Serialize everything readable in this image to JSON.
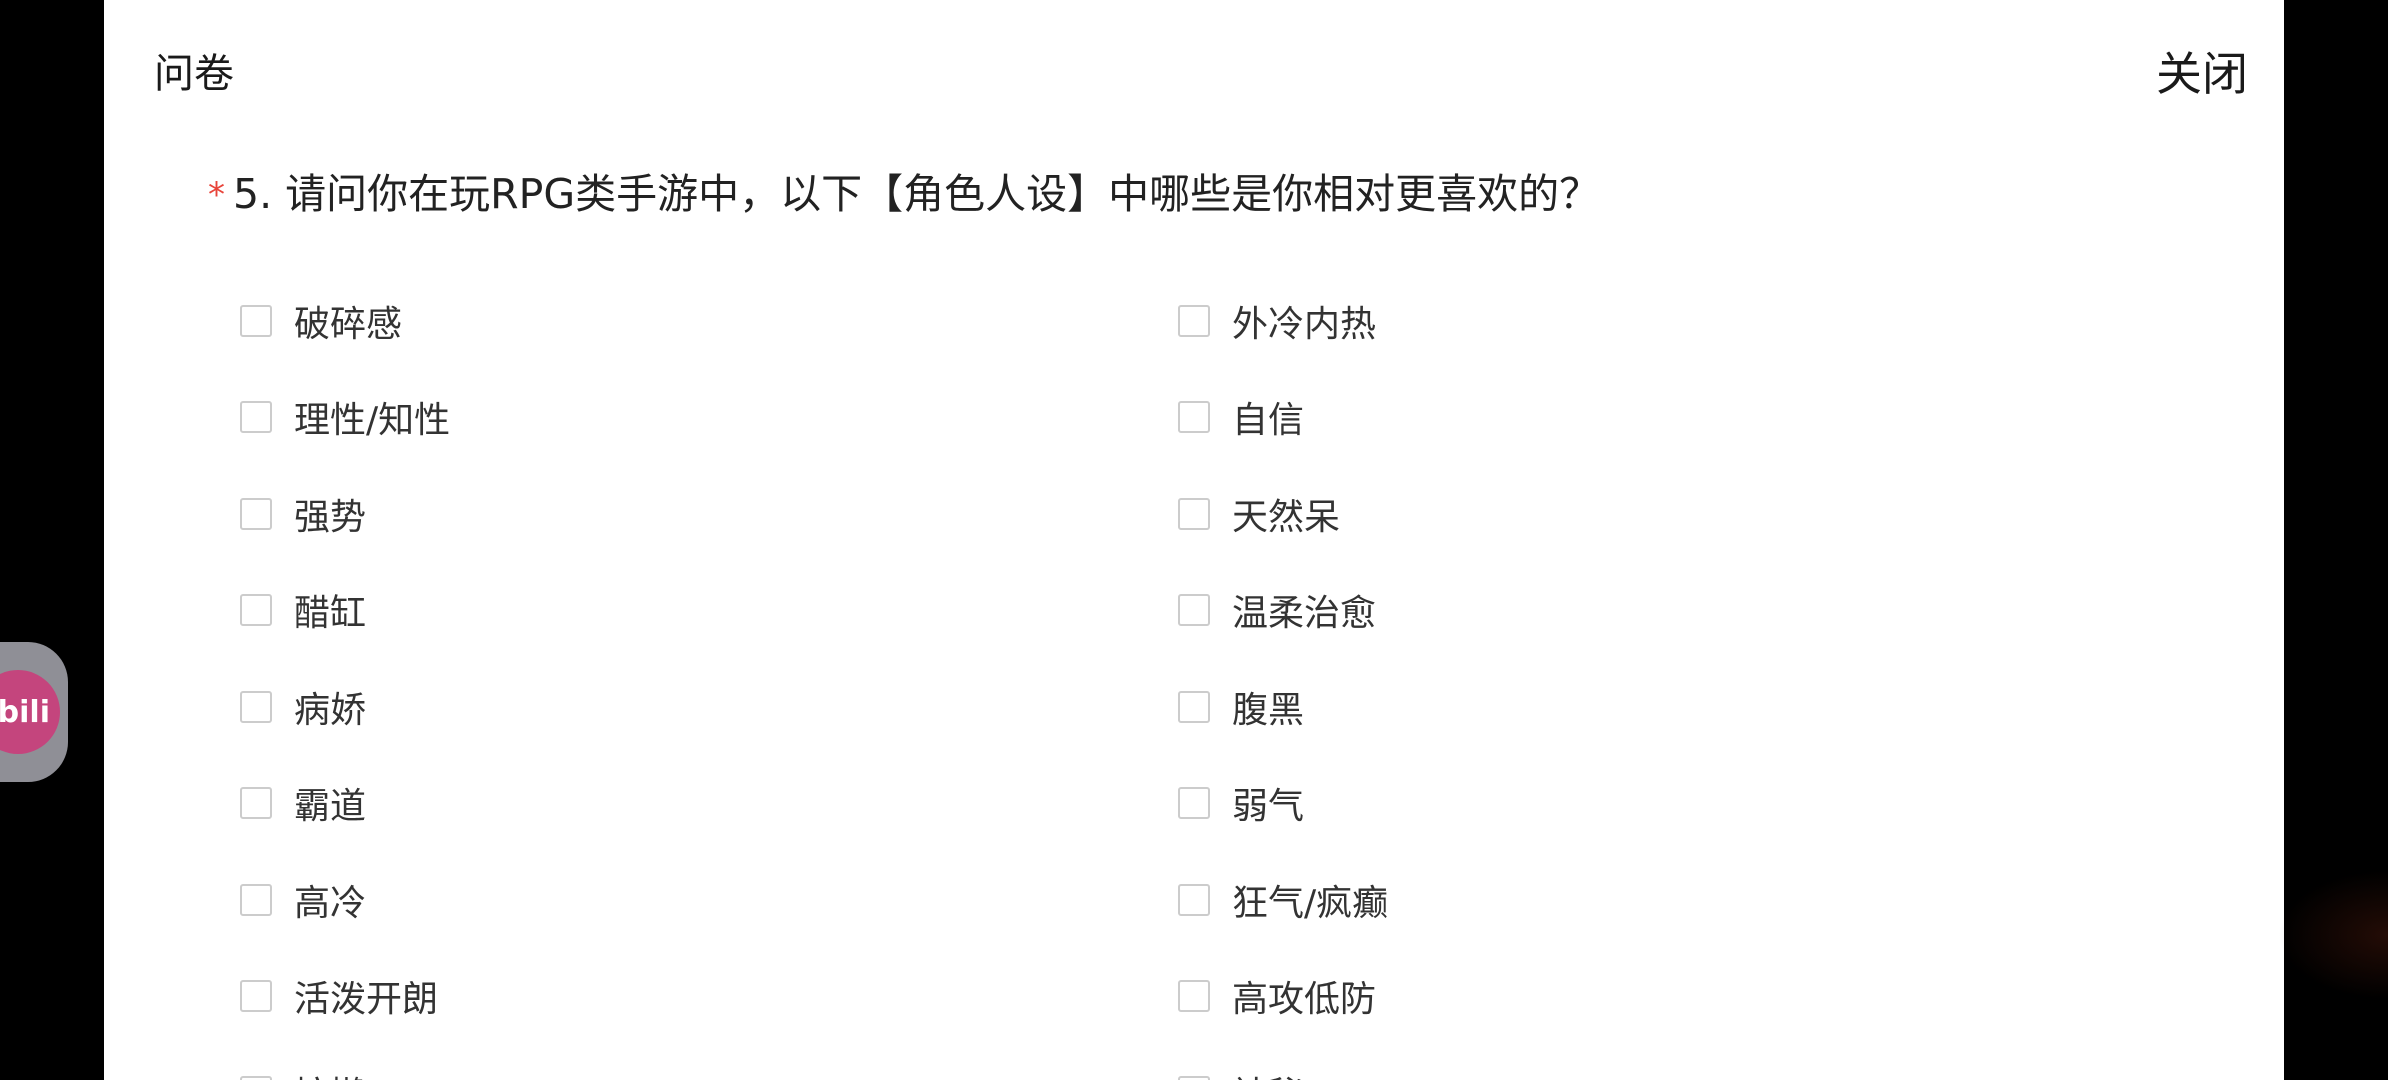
{
  "header": {
    "title": "问卷",
    "close_label": "关闭"
  },
  "question": {
    "required_mark": "*",
    "text": "5. 请问你在玩RPG类手游中，以下【角色人设】中哪些是你相对更喜欢的？"
  },
  "options": {
    "left": [
      {
        "label": "破碎感",
        "checked": false
      },
      {
        "label": "理性/知性",
        "checked": false
      },
      {
        "label": "强势",
        "checked": false
      },
      {
        "label": "醋缸",
        "checked": false
      },
      {
        "label": "病娇",
        "checked": false
      },
      {
        "label": "霸道",
        "checked": false
      },
      {
        "label": "高冷",
        "checked": false
      },
      {
        "label": "活泼开朗",
        "checked": false
      },
      {
        "label": "慵懒",
        "checked": false
      }
    ],
    "right": [
      {
        "label": "外冷内热",
        "checked": false
      },
      {
        "label": "自信",
        "checked": false
      },
      {
        "label": "天然呆",
        "checked": false
      },
      {
        "label": "温柔治愈",
        "checked": false
      },
      {
        "label": "腹黑",
        "checked": false
      },
      {
        "label": "弱气",
        "checked": false
      },
      {
        "label": "狂气/疯癫",
        "checked": false
      },
      {
        "label": "高攻低防",
        "checked": false
      },
      {
        "label": "神秘",
        "checked": false
      }
    ]
  },
  "floating_button": {
    "text": "bili",
    "icon": "bilibili-icon"
  },
  "colors": {
    "required": "#e8443a",
    "checkbox_border": "#cccccc",
    "bili_pink": "#c4457d",
    "backdrop": "#000000"
  }
}
